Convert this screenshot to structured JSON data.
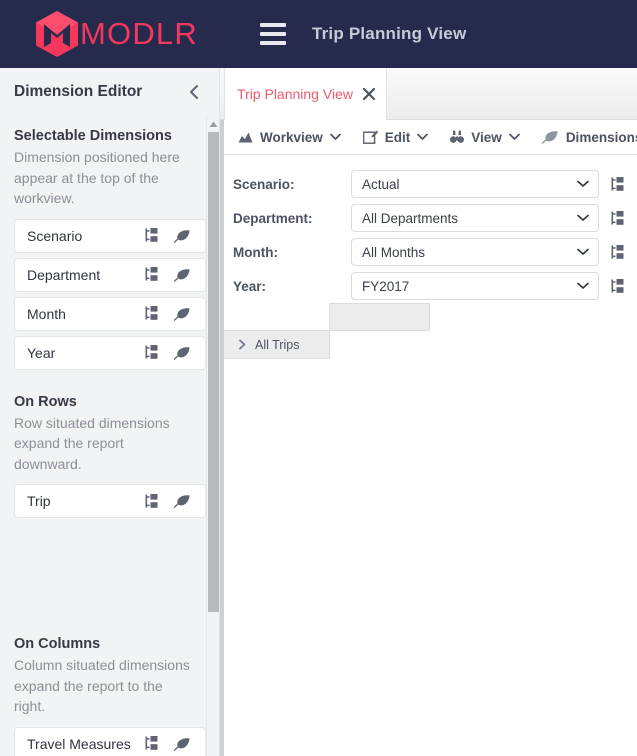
{
  "header": {
    "brand_name": "MODLR",
    "brand_color": "#f4375a",
    "background_color": "#262b4d",
    "menu_icon": "hamburger-icon",
    "title": "Trip Planning View"
  },
  "sidebar": {
    "title": "Dimension Editor",
    "collapse_icon": "chevron-left-icon",
    "sections": [
      {
        "title": "Selectable Dimensions",
        "description": "Dimension positioned here appear at the top of the workview.",
        "items": [
          {
            "label": "Scenario",
            "hierarchy_icon": "hierarchy-icon",
            "leaf_icon": "leaf-icon"
          },
          {
            "label": "Department",
            "hierarchy_icon": "hierarchy-icon",
            "leaf_icon": "leaf-icon"
          },
          {
            "label": "Month",
            "hierarchy_icon": "hierarchy-icon",
            "leaf_icon": "leaf-icon"
          },
          {
            "label": "Year",
            "hierarchy_icon": "hierarchy-icon",
            "leaf_icon": "leaf-icon"
          }
        ]
      },
      {
        "title": "On Rows",
        "description": "Row situated dimensions expand the report downward.",
        "items": [
          {
            "label": "Trip",
            "hierarchy_icon": "hierarchy-icon",
            "leaf_icon": "leaf-icon"
          }
        ]
      },
      {
        "title": "On Columns",
        "description": "Column situated dimensions expand the report to the right.",
        "items": [
          {
            "label": "Travel Measures",
            "hierarchy_icon": "hierarchy-icon",
            "leaf_icon": "leaf-icon"
          }
        ]
      }
    ]
  },
  "main": {
    "tab": {
      "label": "Trip Planning View",
      "close_icon": "close-icon",
      "active_color": "#f05a6e"
    },
    "toolbar": [
      {
        "label": "Workview",
        "icon": "chart-icon",
        "caret": "chevron-down-icon",
        "has_caret": true
      },
      {
        "label": "Edit",
        "icon": "pencil-icon",
        "caret": "chevron-down-icon",
        "has_caret": true
      },
      {
        "label": "View",
        "icon": "binoculars-icon",
        "caret": "chevron-down-icon",
        "has_caret": true
      },
      {
        "label": "Dimensions",
        "icon": "leaf-icon",
        "caret": "",
        "has_caret": false
      }
    ],
    "selectors": [
      {
        "label": "Scenario:",
        "value": "Actual",
        "caret": "chevron-down-icon",
        "side_icon": "hierarchy-icon"
      },
      {
        "label": "Department:",
        "value": "All Departments",
        "caret": "chevron-down-icon",
        "side_icon": "hierarchy-icon"
      },
      {
        "label": "Month:",
        "value": "All Months",
        "caret": "chevron-down-icon",
        "side_icon": "hierarchy-icon"
      },
      {
        "label": "Year:",
        "value": "FY2017",
        "caret": "chevron-down-icon",
        "side_icon": "hierarchy-icon"
      }
    ],
    "grid": {
      "corner_label": "",
      "column_header_label": "",
      "rows": [
        {
          "label": "All Trips",
          "expander_icon": "chevron-right-icon",
          "value": ""
        }
      ]
    }
  }
}
